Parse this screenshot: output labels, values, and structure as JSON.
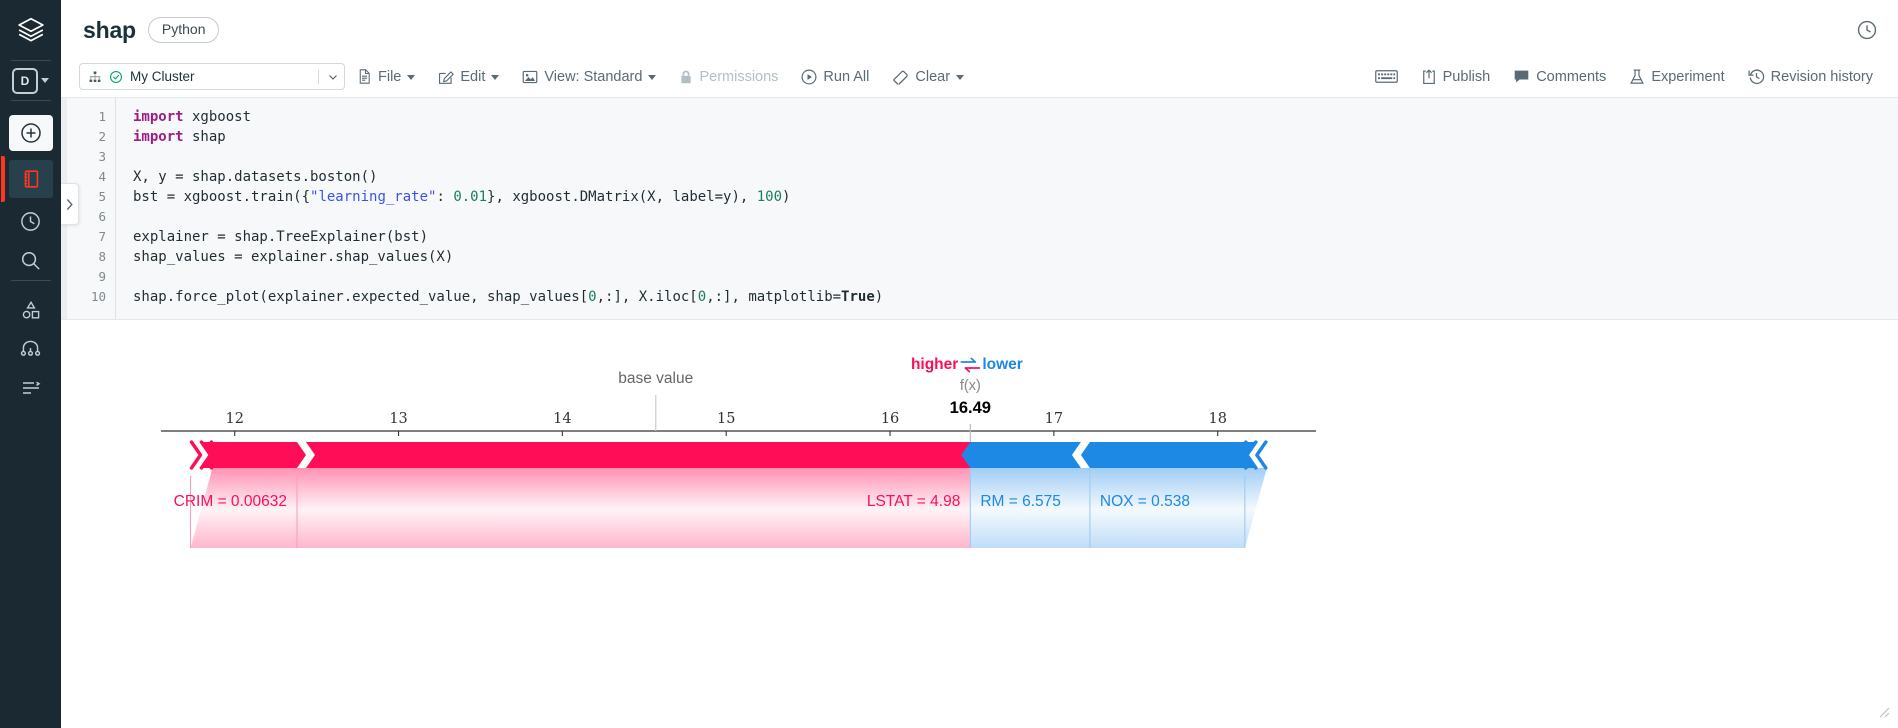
{
  "rail": {
    "logo_icon": "databricks-layers-logo",
    "items": [
      {
        "icon": "workspace-d-icon",
        "name": "workspace-switcher"
      },
      {
        "icon": "plus-circle-icon",
        "name": "new-item"
      },
      {
        "icon": "notebook-icon",
        "name": "notebook"
      },
      {
        "icon": "clock-icon",
        "name": "recents"
      },
      {
        "icon": "search-icon",
        "name": "search"
      },
      {
        "icon": "shapes-icon",
        "name": "data"
      },
      {
        "icon": "model-tree-icon",
        "name": "models"
      },
      {
        "icon": "list-icon",
        "name": "jobs"
      }
    ]
  },
  "header": {
    "notebook_title": "shap",
    "language_badge": "Python",
    "history_icon": "clock-circle-icon"
  },
  "toolbar": {
    "cluster": {
      "icon": "cluster-icon",
      "status_icon": "check-circle-green-icon",
      "name": "My Cluster",
      "caret_icon": "chevron-down-icon"
    },
    "menus": [
      {
        "label": "File",
        "icon": "file-icon",
        "caret": true,
        "disabled": false
      },
      {
        "label": "Edit",
        "icon": "edit-pencil-icon",
        "caret": true,
        "disabled": false
      },
      {
        "label": "View: Standard",
        "icon": "view-image-icon",
        "caret": true,
        "disabled": false
      },
      {
        "label": "Permissions",
        "icon": "lock-icon",
        "caret": false,
        "disabled": true
      },
      {
        "label": "Run All",
        "icon": "play-circle-icon",
        "caret": false,
        "disabled": false
      },
      {
        "label": "Clear",
        "icon": "eraser-icon",
        "caret": true,
        "disabled": false
      }
    ],
    "right_items": [
      {
        "label": "",
        "icon": "keyboard-icon"
      },
      {
        "label": "Publish",
        "icon": "publish-share-icon"
      },
      {
        "label": "Comments",
        "icon": "comment-bubble-icon"
      },
      {
        "label": "Experiment",
        "icon": "flask-icon"
      },
      {
        "label": "Revision history",
        "icon": "revision-history-icon"
      }
    ]
  },
  "cell": {
    "line_numbers": [
      "1",
      "2",
      "3",
      "4",
      "5",
      "6",
      "7",
      "8",
      "9",
      "10"
    ],
    "lines": [
      [
        {
          "t": "import",
          "c": "kw"
        },
        {
          "t": " xgboost",
          "c": ""
        }
      ],
      [
        {
          "t": "import",
          "c": "kw"
        },
        {
          "t": " shap",
          "c": ""
        }
      ],
      [],
      [
        {
          "t": "X, y = shap.datasets.boston()",
          "c": ""
        }
      ],
      [
        {
          "t": "bst = xgboost.train({",
          "c": ""
        },
        {
          "t": "\"learning_rate\"",
          "c": "str"
        },
        {
          "t": ": ",
          "c": ""
        },
        {
          "t": "0.01",
          "c": "num"
        },
        {
          "t": "}, xgboost.DMatrix(X, label=y), ",
          "c": ""
        },
        {
          "t": "100",
          "c": "num"
        },
        {
          "t": ")",
          "c": ""
        }
      ],
      [],
      [
        {
          "t": "explainer = shap.TreeExplainer(bst)",
          "c": ""
        }
      ],
      [
        {
          "t": "shap_values = explainer.shap_values(X)",
          "c": ""
        }
      ],
      [],
      [
        {
          "t": "shap.force_plot(explainer.expected_value, shap_values[",
          "c": ""
        },
        {
          "t": "0",
          "c": "num"
        },
        {
          "t": ",:], X.iloc[",
          "c": ""
        },
        {
          "t": "0",
          "c": "num"
        },
        {
          "t": ",:], matplotlib=",
          "c": ""
        },
        {
          "t": "True",
          "c": "bool"
        },
        {
          "t": ")",
          "c": ""
        }
      ]
    ]
  },
  "chart_data": {
    "type": "bar",
    "chart_kind": "shap-force-plot",
    "title": "",
    "xlabel": "",
    "ylabel": "",
    "base_value_label": "base value",
    "base_value": 14.57,
    "output_label": "f(x)",
    "output_value": "16.49",
    "higher_label": "higher",
    "lower_label": "lower",
    "arrow_icon": "left-right-arrows-icon",
    "axis_ticks": [
      "12",
      "13",
      "14",
      "15",
      "16",
      "17",
      "18"
    ],
    "axis_tick_values": [
      12,
      13,
      14,
      15,
      16,
      17,
      18
    ],
    "xlim": [
      11.55,
      18.6
    ],
    "grid": false,
    "legend": "none",
    "positive_color": "#ff0d57",
    "negative_color": "#1e88e5",
    "features": [
      {
        "label": "CRIM = 0.00632",
        "name": "CRIM",
        "value": "0.00632",
        "direction": "higher",
        "start": 11.73,
        "end": 12.38
      },
      {
        "label": "LSTAT = 4.98",
        "name": "LSTAT",
        "value": "4.98",
        "direction": "higher",
        "start": 12.38,
        "end": 16.49
      },
      {
        "label": "RM = 6.575",
        "name": "RM",
        "value": "6.575",
        "direction": "lower",
        "start": 16.49,
        "end": 17.22
      },
      {
        "label": "NOX = 0.538",
        "name": "NOX",
        "value": "0.538",
        "direction": "lower",
        "start": 17.22,
        "end": 18.3
      }
    ]
  }
}
